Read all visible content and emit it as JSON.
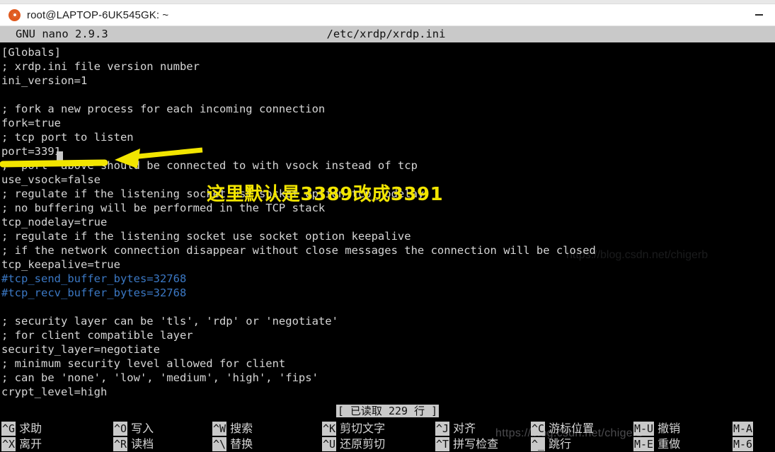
{
  "window": {
    "title": "root@LAPTOP-6UK545GK: ~",
    "logo_icon": "ubuntu-logo",
    "minimize_label": "—"
  },
  "nano": {
    "version": "GNU nano 2.9.3",
    "filename": "/etc/xrdp/xrdp.ini",
    "status_message": "[ 已读取 229 行 ]"
  },
  "editor": {
    "lines": [
      {
        "text": "[Globals]",
        "color": "default"
      },
      {
        "text": "; xrdp.ini file version number",
        "color": "default"
      },
      {
        "text": "ini_version=1",
        "color": "default"
      },
      {
        "text": "",
        "color": "default"
      },
      {
        "text": "; fork a new process for each incoming connection",
        "color": "default"
      },
      {
        "text": "fork=true",
        "color": "default"
      },
      {
        "text": "; tcp port to listen",
        "color": "default"
      },
      {
        "text": "port=3391",
        "color": "default"
      },
      {
        "text": "; 'port' above should be connected to with vsock instead of tcp",
        "color": "default"
      },
      {
        "text": "use_vsock=false",
        "color": "default"
      },
      {
        "text": "; regulate if the listening socket use socket option tcp_nodelay",
        "color": "default"
      },
      {
        "text": "; no buffering will be performed in the TCP stack",
        "color": "default"
      },
      {
        "text": "tcp_nodelay=true",
        "color": "default"
      },
      {
        "text": "; regulate if the listening socket use socket option keepalive",
        "color": "default"
      },
      {
        "text": "; if the network connection disappear without close messages the connection will be closed",
        "color": "default"
      },
      {
        "text": "tcp_keepalive=true",
        "color": "default"
      },
      {
        "text": "#tcp_send_buffer_bytes=32768",
        "color": "blue"
      },
      {
        "text": "#tcp_recv_buffer_bytes=32768",
        "color": "blue"
      },
      {
        "text": "",
        "color": "default"
      },
      {
        "text": "; security layer can be 'tls', 'rdp' or 'negotiate'",
        "color": "default"
      },
      {
        "text": "; for client compatible layer",
        "color": "default"
      },
      {
        "text": "security_layer=negotiate",
        "color": "default"
      },
      {
        "text": "; minimum security level allowed for client",
        "color": "default"
      },
      {
        "text": "; can be 'none', 'low', 'medium', 'high', 'fips'",
        "color": "default"
      },
      {
        "text": "crypt_level=high",
        "color": "default"
      }
    ]
  },
  "annotation": {
    "note_text": "这里默认是3389改成3391",
    "arrow_color": "#f2e500",
    "highlight_color": "#f2e500"
  },
  "shortcuts": [
    {
      "key1": "^G",
      "label1": "求助",
      "key2": "^X",
      "label2": "离开"
    },
    {
      "key1": "^O",
      "label1": "写入",
      "key2": "^R",
      "label2": "读档"
    },
    {
      "key1": "^W",
      "label1": "搜索",
      "key2": "^\\",
      "label2": "替换"
    },
    {
      "key1": "^K",
      "label1": "剪切文字",
      "key2": "^U",
      "label2": "还原剪切"
    },
    {
      "key1": "^J",
      "label1": "对齐",
      "key2": "^T",
      "label2": "拼写检查"
    },
    {
      "key1": "^C",
      "label1": "游标位置",
      "key2": "^_",
      "label2": "跳行"
    },
    {
      "key1": "M-U",
      "label1": "撤销",
      "key2": "M-E",
      "label2": "重做"
    },
    {
      "key1": "M-A",
      "label1": "",
      "key2": "M-6",
      "label2": ""
    }
  ],
  "watermark": {
    "text": "https://blog.csdn.net/chigerb"
  }
}
